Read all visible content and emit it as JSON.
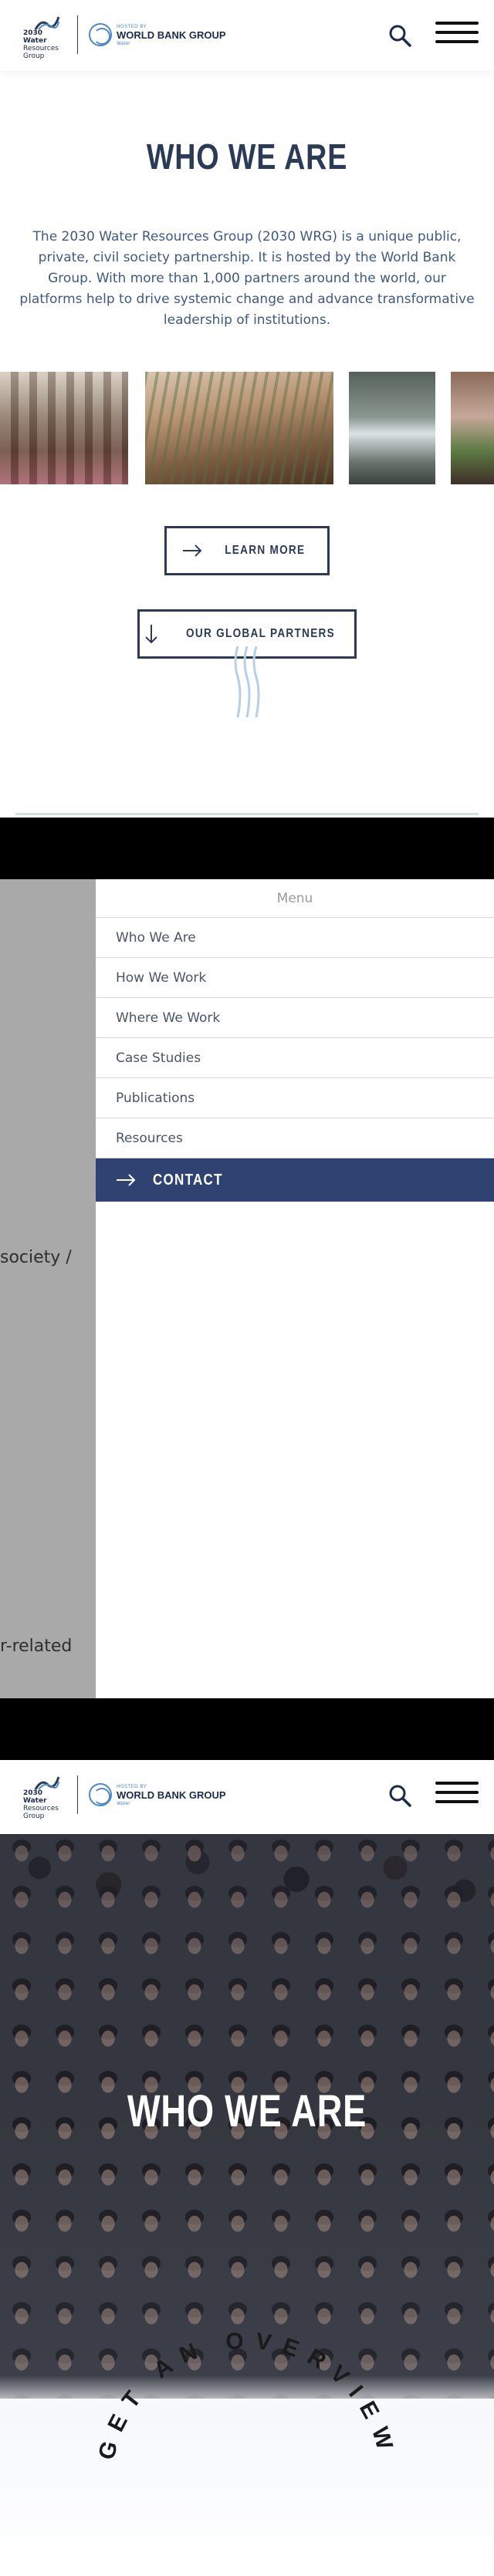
{
  "header": {
    "logo_lines": [
      "2030",
      "Water",
      "Resources",
      "Group"
    ],
    "hosted_by": "HOSTED BY",
    "wbg_name": "WORLD BANK GROUP",
    "wbg_sub": "Water",
    "search_icon": "search-icon",
    "menu_icon": "hamburger-icon"
  },
  "intro": {
    "title": "WHO WE ARE",
    "body": "The 2030 Water Resources Group (2030 WRG) is a unique public, private, civil society partnership. It is hosted by the World Bank Group. With more than 1,000 partners around the world, our platforms help to drive systemic change and advance transformative leadership of institutions.",
    "learn_more": "LEARN MORE",
    "global_partners": "OUR GLOBAL PARTNERS"
  },
  "menu": {
    "heading": "Menu",
    "items": [
      {
        "label": "Who We Are"
      },
      {
        "label": "How We Work"
      },
      {
        "label": "Where We Work"
      },
      {
        "label": "Case Studies"
      },
      {
        "label": "Publications"
      },
      {
        "label": "Resources"
      }
    ],
    "contact": "CONTACT",
    "backdrop_fragments": [
      "society /",
      "r-related"
    ]
  },
  "hero": {
    "title": "WHO WE ARE",
    "overview": "GET AN OVERVIEW"
  }
}
